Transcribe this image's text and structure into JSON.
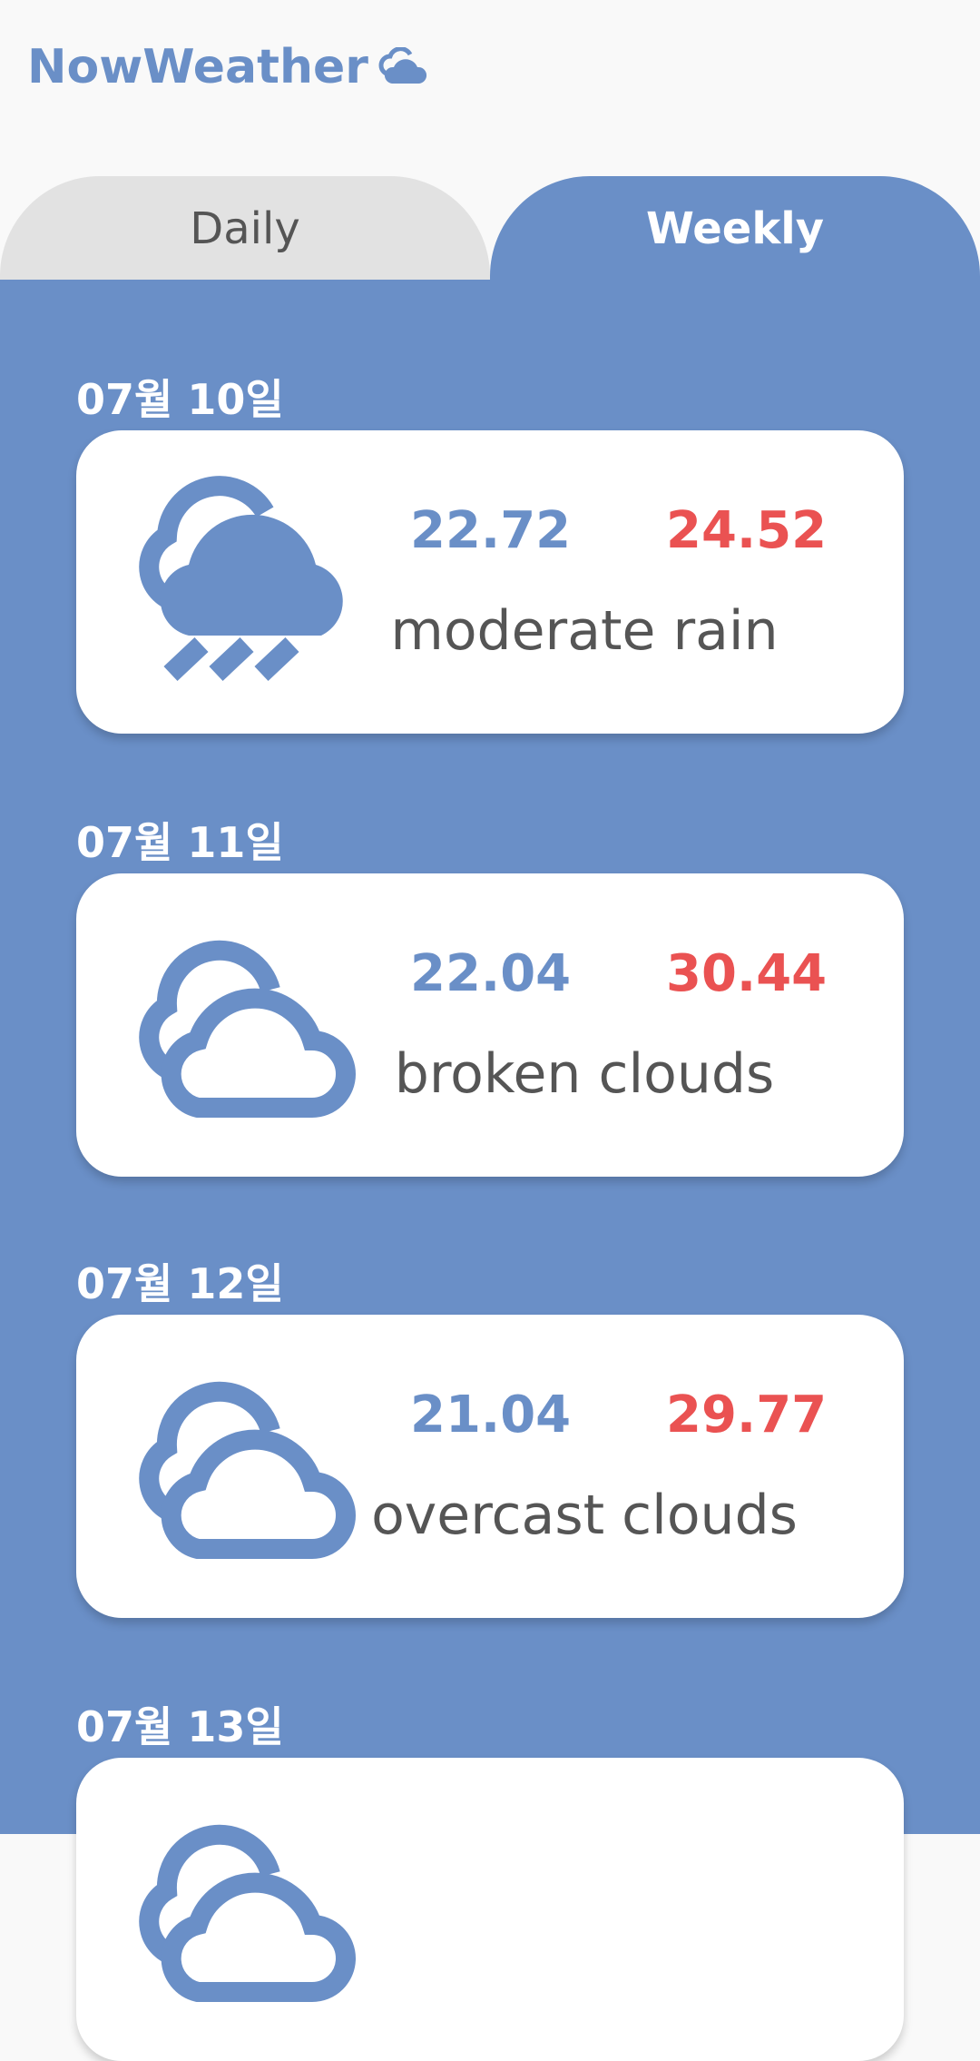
{
  "app": {
    "title": "NowWeather",
    "title_icon": "cloud-icon",
    "accent_color": "#6a8fc7",
    "max_temp_color": "#ea5252"
  },
  "tabs": [
    {
      "label": "Daily",
      "active": false
    },
    {
      "label": "Weekly",
      "active": true
    }
  ],
  "forecast": [
    {
      "date": "07월 10일",
      "icon": "rain-cloud-icon",
      "temp_min": "22.72",
      "temp_max": "24.52",
      "description": "moderate rain"
    },
    {
      "date": "07월 11일",
      "icon": "broken-clouds-icon",
      "temp_min": "22.04",
      "temp_max": "30.44",
      "description": "broken clouds"
    },
    {
      "date": "07월 12일",
      "icon": "overcast-clouds-icon",
      "temp_min": "21.04",
      "temp_max": "29.77",
      "description": "overcast clouds"
    },
    {
      "date": "07월 13일",
      "icon": "clouds-icon",
      "temp_min": "",
      "temp_max": "",
      "description": ""
    }
  ]
}
